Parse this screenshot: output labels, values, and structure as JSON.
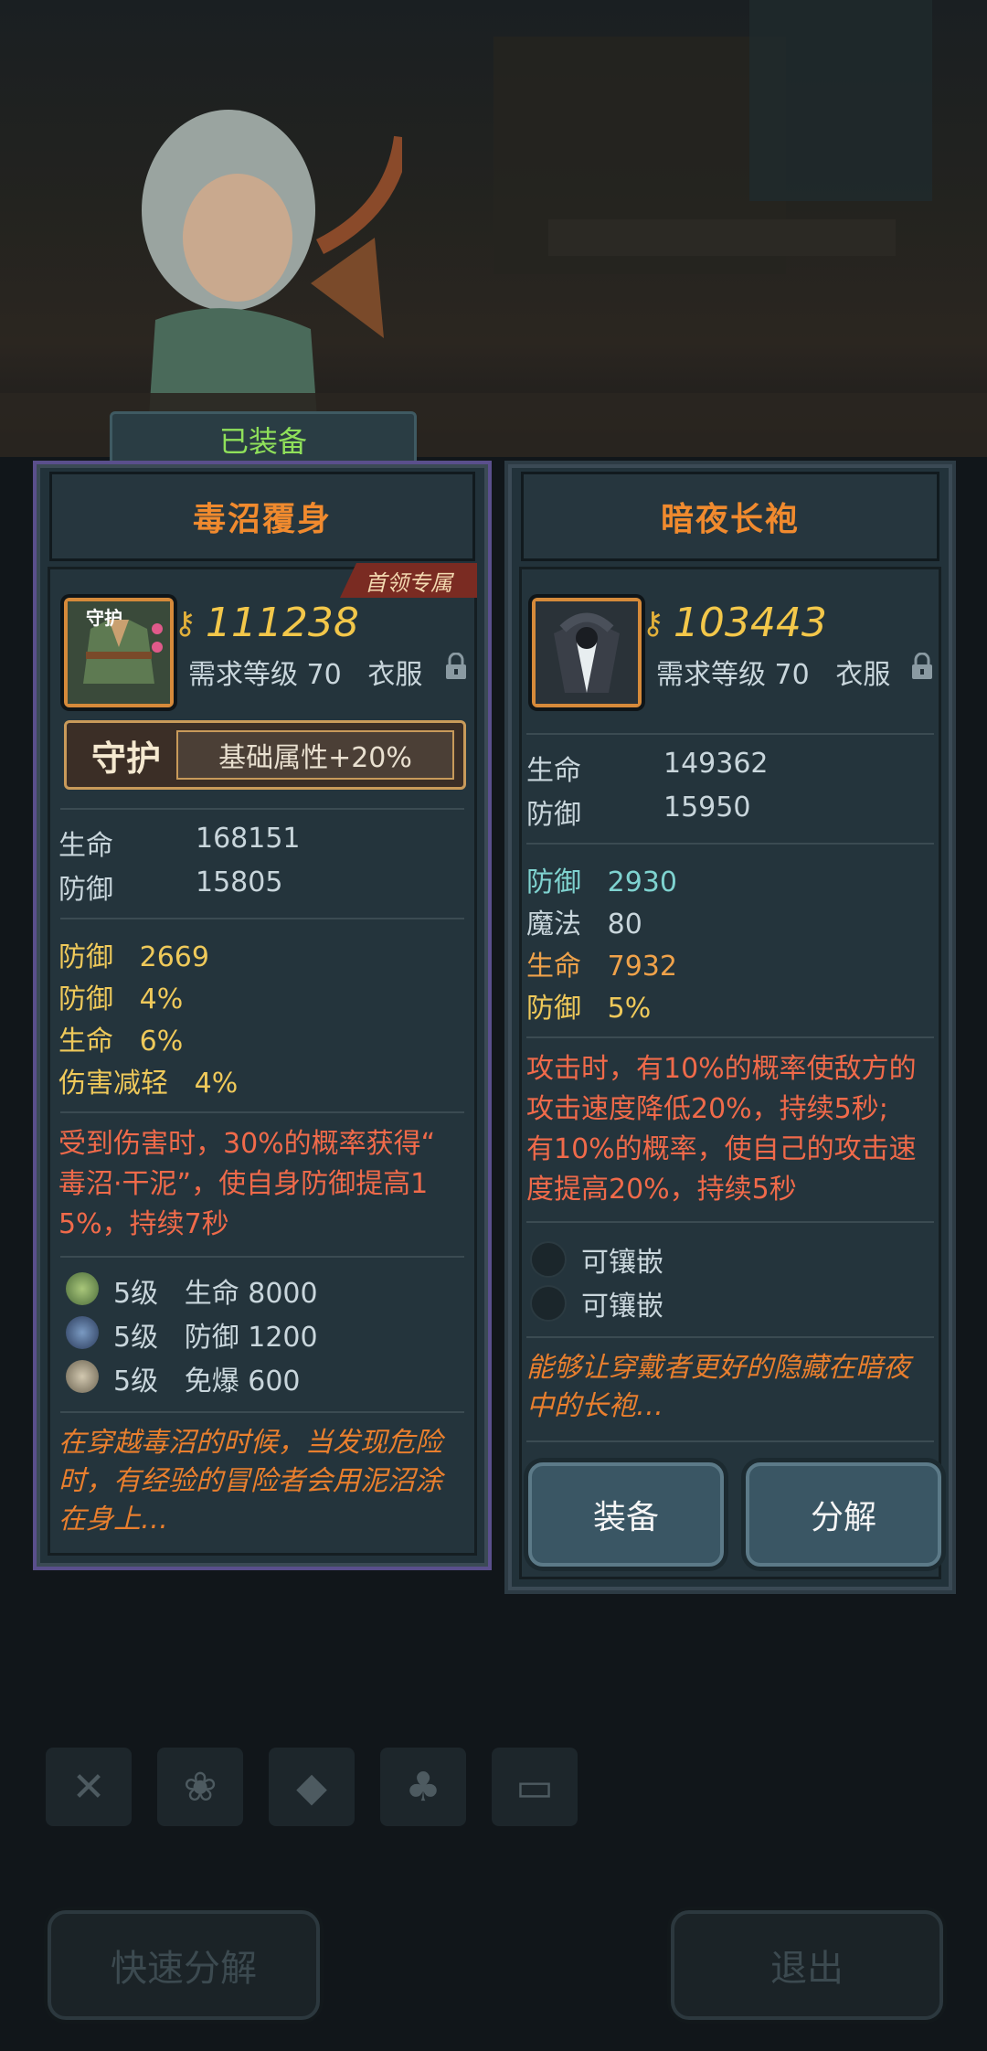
{
  "equipped_label": "已装备",
  "left_item": {
    "name": "毒沼覆身",
    "tag": "首领专属",
    "icon_label": "守护",
    "power": "111238",
    "req_level": "需求等级 70",
    "slot": "衣服",
    "guard_name": "守护",
    "guard_bonus": "基础属性+20%",
    "base_stats": [
      {
        "name": "生命",
        "value": "168151"
      },
      {
        "name": "防御",
        "value": "15805"
      }
    ],
    "extra_stats": [
      {
        "name": "防御",
        "value": "2669"
      },
      {
        "name": "防御",
        "value": "4%"
      },
      {
        "name": "生命",
        "value": "6%"
      },
      {
        "name": "伤害减轻",
        "value": "4%"
      }
    ],
    "effect_lines": [
      "受到伤害时，30%的概率获得“",
      "毒沼·干泥”，使自身防御提高1",
      "5%，持续7秒"
    ],
    "gems": [
      {
        "level": "5级",
        "stat": "生命 8000",
        "color": "#7da35a"
      },
      {
        "level": "5级",
        "stat": "防御 1200",
        "color": "#4a6a8a"
      },
      {
        "level": "5级",
        "stat": "免爆 600",
        "color": "#a8a08a"
      }
    ],
    "flavor_lines": [
      "在穿越毒沼的时候，当发现危险",
      "时，有经验的冒险者会用泥沼涂",
      "在身上…"
    ]
  },
  "right_item": {
    "name": "暗夜长袍",
    "power": "103443",
    "req_level": "需求等级 70",
    "slot": "衣服",
    "base_stats": [
      {
        "name": "生命",
        "value": "149362"
      },
      {
        "name": "防御",
        "value": "15950"
      }
    ],
    "extra_stats": [
      {
        "name": "防御",
        "value": "2930",
        "color": "cyan"
      },
      {
        "name": "魔法",
        "value": "80",
        "color": "grey"
      },
      {
        "name": "生命",
        "value": "7932",
        "color": "orange"
      },
      {
        "name": "防御",
        "value": "5%",
        "color": "yellow"
      }
    ],
    "effect_lines": [
      "攻击时，有10%的概率使敌方的",
      "攻击速度降低20%，持续5秒;",
      "有10%的概率，使自己的攻击速",
      "度提高20%，持续5秒"
    ],
    "sockets": [
      "可镶嵌",
      "可镶嵌"
    ],
    "flavor_lines": [
      "能够让穿戴者更好的隐藏在暗夜",
      "中的长袍…"
    ],
    "equip_button": "装备",
    "dismantle_button": "分解"
  },
  "bottom": {
    "quick_dismantle": "快速分解",
    "exit": "退出"
  },
  "toolbar_icons": [
    "weapon-filter-icon",
    "paw-filter-icon",
    "gem-filter-icon",
    "tree-filter-icon",
    "chest-filter-icon"
  ]
}
